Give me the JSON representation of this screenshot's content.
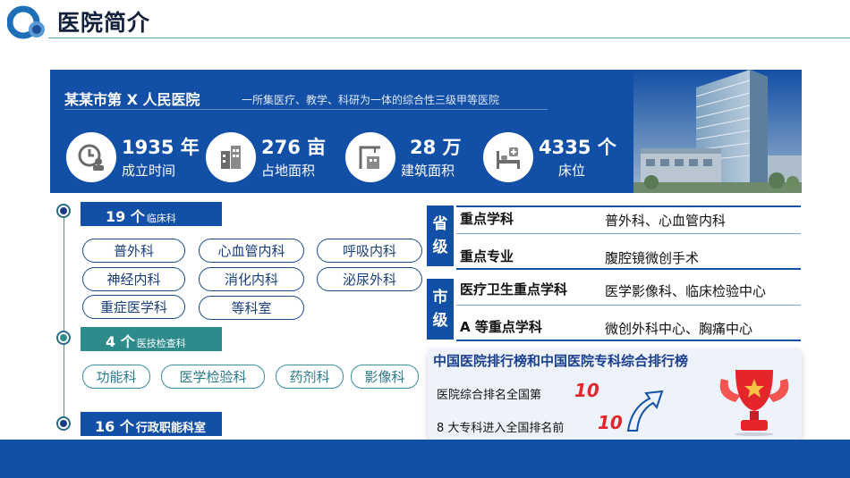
{
  "header": {
    "title": "医院简介"
  },
  "banner": {
    "hospital_name": "某某市第 X 人民医院",
    "subtitle": "一所集医疗、教学、科研为一体的综合性三级甲等医院",
    "stats": [
      {
        "value": "1935 年",
        "label": "成立时间",
        "icon": "clock-person-icon"
      },
      {
        "value": "276 亩",
        "label": "占地面积",
        "icon": "buildings-icon"
      },
      {
        "value": "28 万",
        "label": "建筑面积",
        "icon": "construction-crane-icon"
      },
      {
        "value": "4335 个",
        "label": "床位",
        "icon": "hospital-bed-icon"
      }
    ]
  },
  "sections": [
    {
      "count": "19 个",
      "label": "临床科",
      "items": [
        "普外科",
        "心血管内科",
        "呼吸内科",
        "神经内科",
        "消化内科",
        "泌尿外科",
        "重症医学科",
        "等科室"
      ]
    },
    {
      "count": "4 个",
      "label": "医技检查科",
      "items": [
        "功能科",
        "医学检验科",
        "药剂科",
        "影像科"
      ]
    },
    {
      "count": "16 个",
      "label": "行政职能科室",
      "items": []
    }
  ],
  "key_disciplines": {
    "groups": [
      {
        "level": "省级",
        "chars": [
          "省",
          "级"
        ],
        "rows": [
          {
            "key": "重点学科",
            "value": "普外科、心血管内科"
          },
          {
            "key": "重点专业",
            "value": "腹腔镜微创手术"
          }
        ]
      },
      {
        "level": "市级",
        "chars": [
          "市",
          "级"
        ],
        "rows": [
          {
            "key": "医疗卫生重点学科",
            "value": "医学影像科、临床检验中心"
          },
          {
            "key": "A 等重点学科",
            "value": "微创外科中心、胸痛中心"
          }
        ]
      }
    ]
  },
  "ranking": {
    "title": "中国医院排行榜和中国医院专科综合排行榜",
    "lines": [
      {
        "text": "医院综合排名全国第",
        "number": "10"
      },
      {
        "text": "8 大专科进入全国排名前",
        "number": "10"
      }
    ]
  },
  "colors": {
    "primary": "#124fa6",
    "teal": "#2e8b8b",
    "accent_red": "#e4262c",
    "text_dark": "#14213d"
  }
}
